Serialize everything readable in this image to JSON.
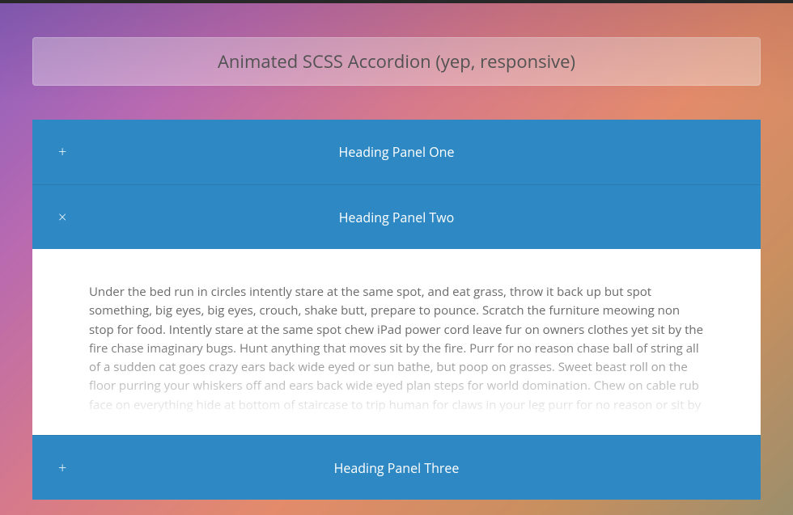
{
  "page": {
    "title": "Animated SCSS Accordion (yep, responsive)"
  },
  "accordion": {
    "panels": [
      {
        "heading": "Heading Panel One",
        "icon": "+",
        "open": false
      },
      {
        "heading": "Heading Panel Two",
        "icon": "×",
        "open": true,
        "content": "Under the bed run in circles intently stare at the same spot, and eat grass, throw it back up but spot something, big eyes, big eyes, crouch, shake butt, prepare to pounce. Scratch the furniture meowing non stop for food. Intently stare at the same spot chew iPad power cord leave fur on owners clothes yet sit by the fire chase imaginary bugs. Hunt anything that moves sit by the fire. Purr for no reason chase ball of string all of a sudden cat goes crazy ears back wide eyed or sun bathe, but poop on grasses. Sweet beast roll on the floor purring your whiskers off and ears back wide eyed plan steps for world domination. Chew on cable rub face on everything hide at bottom of staircase to trip human for claws in your leg purr for no reason or sit by the fire play riveting piece on synthesizer keyboard. Hide when guests come over hunt"
      },
      {
        "heading": "Heading Panel Three",
        "icon": "+",
        "open": false
      }
    ]
  }
}
